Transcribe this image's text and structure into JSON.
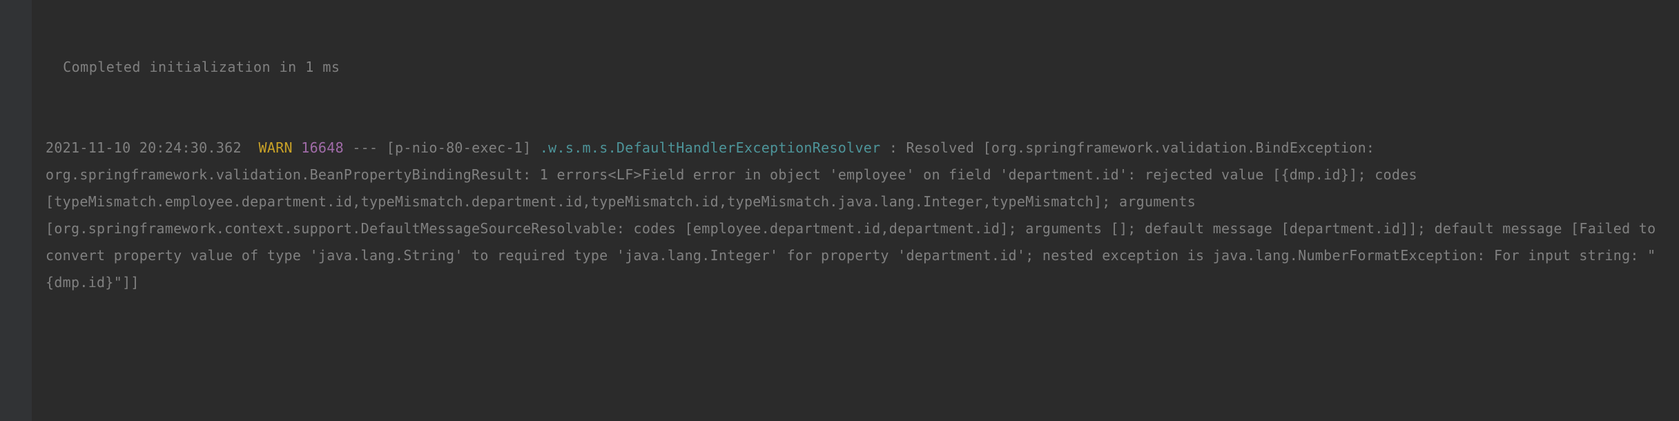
{
  "log": {
    "partial_top_line": "  Completed initialization in 1 ms",
    "entry": {
      "timestamp": "2021-11-10 20:24:30.362",
      "level": "WARN",
      "pid": "16648",
      "separator": "---",
      "thread": "[p-nio-80-exec-1]",
      "logger": ".w.s.m.s.DefaultHandlerExceptionResolver",
      "colon": ":",
      "message": " Resolved [org.springframework.validation.BindException: org.springframework.validation.BeanPropertyBindingResult: 1 errors<LF>Field error in object 'employee' on field 'department.id': rejected value [{dmp.id}]; codes [typeMismatch.employee.department.id,typeMismatch.department.id,typeMismatch.id,typeMismatch.java.lang.Integer,typeMismatch]; arguments [org.springframework.context.support.DefaultMessageSourceResolvable: codes [employee.department.id,department.id]; arguments []; default message [department.id]]; default message [Failed to convert property value of type 'java.lang.String' to required type 'java.lang.Integer' for property 'department.id'; nested exception is java.lang.NumberFormatException: For input string: \"{dmp.id}\"]]"
    }
  }
}
